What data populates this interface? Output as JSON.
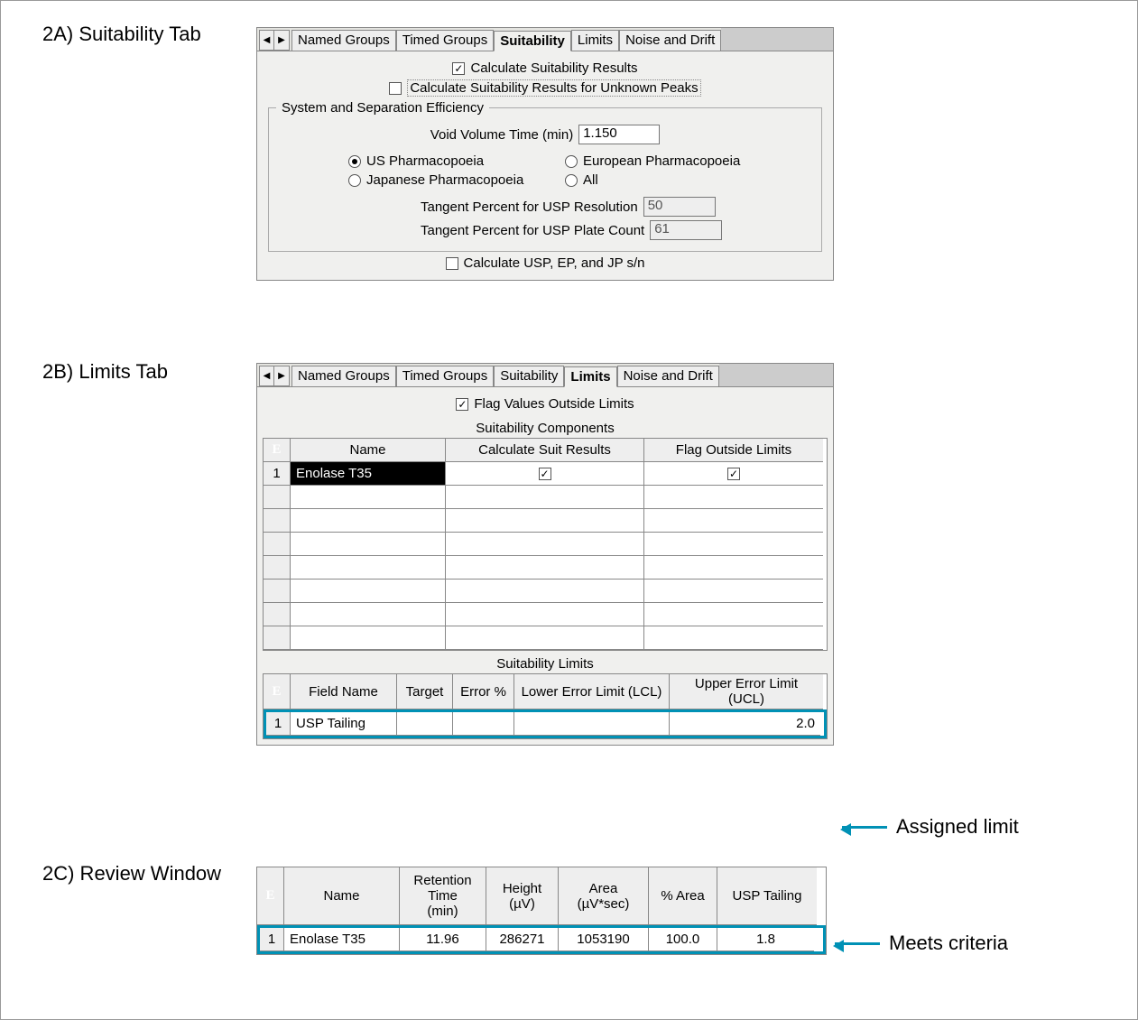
{
  "sections": {
    "a_title": "2A) Suitability Tab",
    "b_title": "2B) Limits Tab",
    "c_title": "2C) Review Window"
  },
  "tabs": {
    "named_groups": "Named Groups",
    "timed_groups": "Timed Groups",
    "suitability": "Suitability",
    "limits": "Limits",
    "noise_drift": "Noise and Drift"
  },
  "panel_a": {
    "calc_results": "Calculate Suitability Results",
    "calc_unknown": "Calculate Suitability Results for Unknown Peaks",
    "fieldset_legend": "System and Separation Efficiency",
    "void_label": "Void Volume Time (min)",
    "void_value": "1.150",
    "radio_us": "US Pharmacopoeia",
    "radio_eu": "European Pharmacopoeia",
    "radio_jp": "Japanese Pharmacopoeia",
    "radio_all": "All",
    "tangent_res_label": "Tangent Percent for USP Resolution",
    "tangent_res_value": "50",
    "tangent_plate_label": "Tangent Percent for USP Plate Count",
    "tangent_plate_value": "61",
    "calc_sn": "Calculate USP, EP, and JP s/n"
  },
  "panel_b": {
    "flag_label": "Flag Values Outside Limits",
    "components_title": "Suitability Components",
    "comp_headers": {
      "name": "Name",
      "calc": "Calculate Suit Results",
      "flag": "Flag Outside Limits"
    },
    "comp_row1": {
      "num": "1",
      "name": "Enolase T35"
    },
    "limits_title": "Suitability Limits",
    "limits_headers": {
      "field": "Field Name",
      "target": "Target",
      "error": "Error %",
      "lcl": "Lower Error Limit (LCL)",
      "ucl": "Upper Error Limit (UCL)"
    },
    "limits_row1": {
      "num": "1",
      "field": "USP Tailing",
      "ucl": "2.0"
    }
  },
  "panel_c": {
    "headers": {
      "name": "Name",
      "rt": "Retention\nTime\n(min)",
      "height": "Height\n(µV)",
      "area": "Area\n(µV*sec)",
      "pct": "% Area",
      "tail": "USP Tailing"
    },
    "row1": {
      "num": "1",
      "name": "Enolase T35",
      "rt": "11.96",
      "height": "286271",
      "area": "1053190",
      "pct": "100.0",
      "tail": "1.8"
    }
  },
  "annotations": {
    "assigned": "Assigned limit",
    "meets": "Meets criteria"
  },
  "icons": {
    "corner": "E"
  }
}
